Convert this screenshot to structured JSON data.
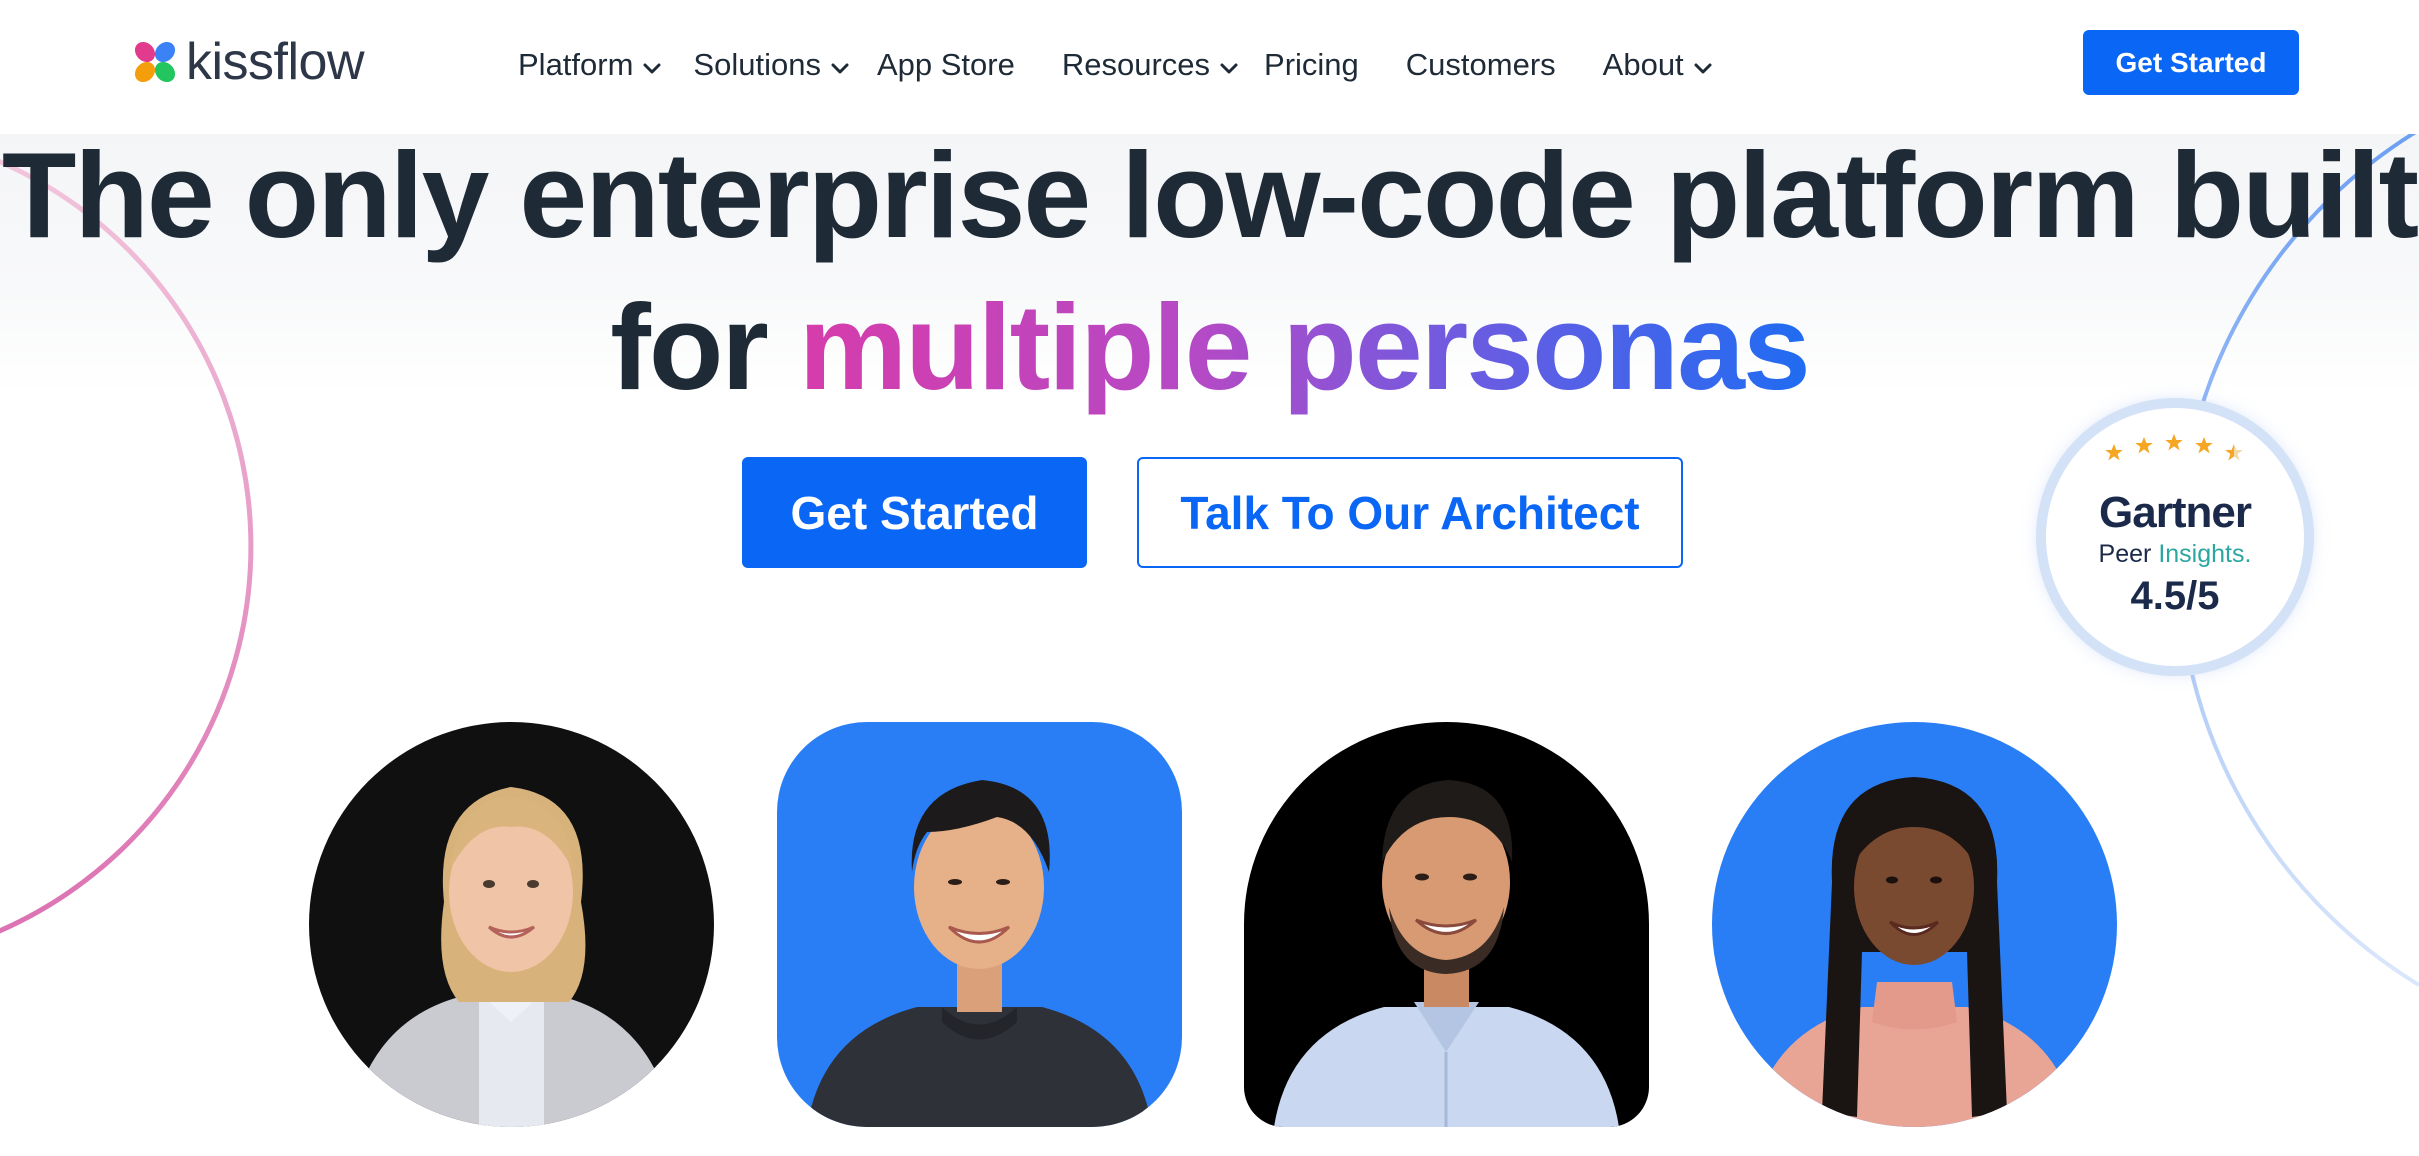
{
  "brand": {
    "name": "kissflow",
    "logo_icon": "butterfly-logo-icon"
  },
  "nav": {
    "items": [
      {
        "label": "Platform",
        "has_dropdown": true
      },
      {
        "label": "Solutions",
        "has_dropdown": true
      },
      {
        "label": "App Store",
        "has_dropdown": false
      },
      {
        "label": "Resources",
        "has_dropdown": true
      },
      {
        "label": "Pricing",
        "has_dropdown": false
      },
      {
        "label": "Customers",
        "has_dropdown": false
      },
      {
        "label": "About",
        "has_dropdown": true
      }
    ],
    "cta_label": "Get Started"
  },
  "hero": {
    "headline_line1": "The only enterprise low-code platform built",
    "headline_prefix": "for ",
    "headline_highlight": "multiple personas",
    "primary_cta": "Get Started",
    "secondary_cta": "Talk To Our Architect"
  },
  "badge": {
    "brand": "Gartner",
    "sub_prefix": "Peer ",
    "sub_highlight": "Insights",
    "sub_suffix": ".",
    "rating": "4.5/5",
    "stars": 4.5,
    "star_color": "#f5a623"
  },
  "personas": [
    {
      "name": "persona-woman-blazer",
      "background": "#101010"
    },
    {
      "name": "persona-man-hoodie",
      "background": "#2a7ef5"
    },
    {
      "name": "persona-man-shirt",
      "background": "#000000"
    },
    {
      "name": "persona-woman-braids",
      "background": "#2a7ef5"
    }
  ],
  "colors": {
    "primary": "#0a66f5",
    "text": "#1f2a37",
    "gradient_start": "#d63cab",
    "gradient_end": "#1f6cf2"
  }
}
